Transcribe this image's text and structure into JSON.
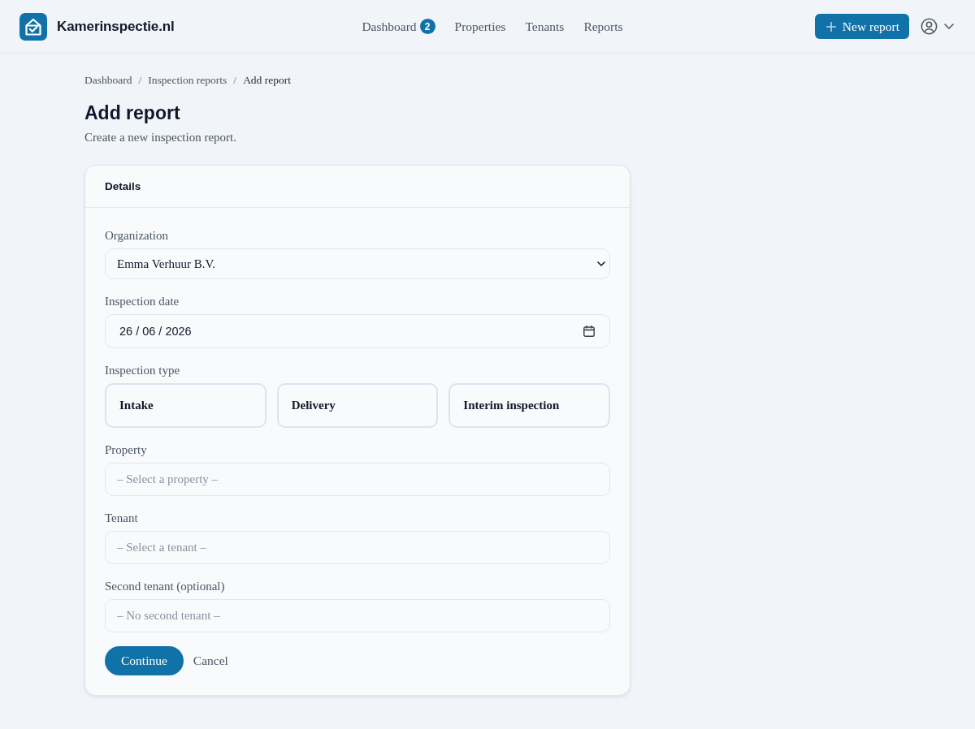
{
  "header": {
    "logo_text": "Kamerinspectie.nl",
    "nav": [
      {
        "label": "Dashboard",
        "badge": "2",
        "selected": false
      },
      {
        "label": "Properties",
        "selected": false
      },
      {
        "label": "Tenants",
        "selected": false
      },
      {
        "label": "Reports",
        "selected": false
      }
    ],
    "new_report_button": "New report"
  },
  "breadcrumb": [
    {
      "label": "Dashboard",
      "current": false
    },
    {
      "separator": "/",
      "label": "Inspection reports",
      "current": false
    },
    {
      "separator": "/",
      "label": "Add report",
      "current": true
    }
  ],
  "page": {
    "title": "Add report",
    "subtitle": "Create a new inspection report."
  },
  "card": {
    "title": "Details",
    "fields": [
      {
        "kind": "select",
        "label": "Organization",
        "value": "Emma Verhuur B.V."
      },
      {
        "kind": "date",
        "label": "Inspection date",
        "value": "26 / 06 / 2026"
      },
      {
        "kind": "choice",
        "label": "Inspection type",
        "options": [
          {
            "label": "Intake",
            "selected": false
          },
          {
            "label": "Delivery",
            "selected": false
          },
          {
            "label": "Interim inspection",
            "selected": false
          }
        ]
      },
      {
        "kind": "search",
        "label": "Property",
        "placeholder": "– Select a property –"
      },
      {
        "kind": "search",
        "label": "Tenant",
        "placeholder": "– Select a tenant –"
      },
      {
        "kind": "search",
        "label": "Second tenant (optional)",
        "placeholder": "– No second tenant –"
      }
    ],
    "actions": [
      {
        "kind": "primary",
        "label": "Continue"
      },
      {
        "kind": "link",
        "label": "Cancel"
      }
    ]
  }
}
